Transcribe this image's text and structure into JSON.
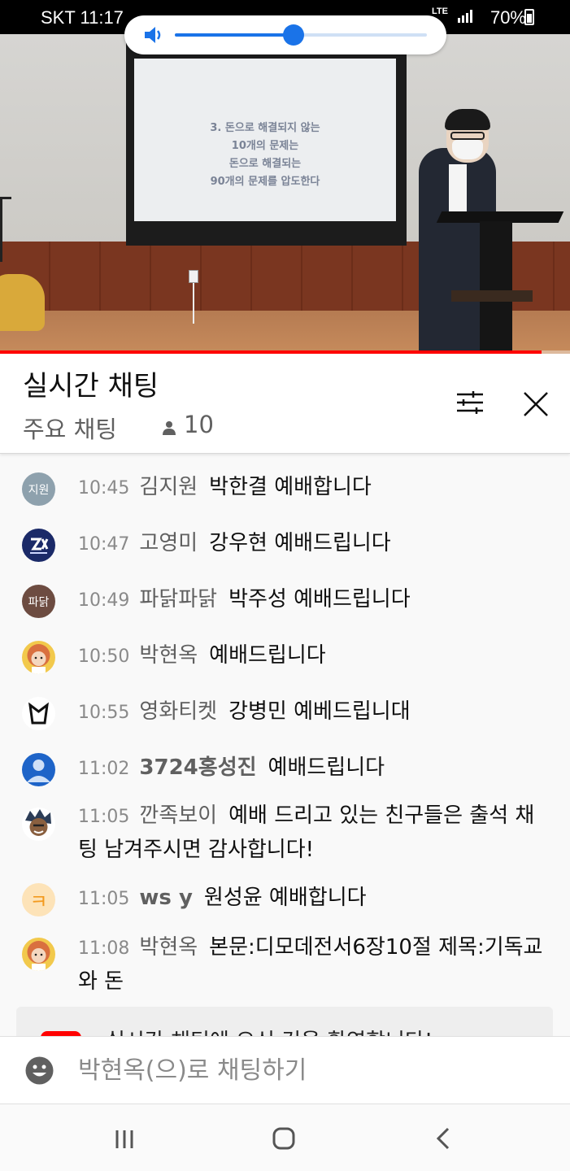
{
  "status_bar": {
    "carrier_time": "SKT 11:17",
    "network": "LTE",
    "battery": "70%"
  },
  "video": {
    "slide_lines": [
      "3. 돈으로 해결되지 않는",
      "10개의 문제는",
      "돈으로 해결되는",
      "90개의 문제를 압도한다"
    ],
    "progress_fraction": 0.95
  },
  "volume": {
    "level_fraction": 0.47,
    "icon": "speaker-icon"
  },
  "chat": {
    "title": "실시간 채팅",
    "mode": "주요 채팅",
    "viewer_count": "10",
    "filter_icon": "tune-icon",
    "close_icon": "close-icon"
  },
  "messages": [
    {
      "time": "10:45",
      "author": "김지원",
      "text": "박한결 예배합니다",
      "avatar_label": "지원",
      "avatar_color": "#8ea1ad"
    },
    {
      "time": "10:47",
      "author": "고영미",
      "text": "강우현 예배드립니다",
      "avatar_label": "",
      "avatar_color": "#1b2a68"
    },
    {
      "time": "10:49",
      "author": "파닭파닭",
      "text": "박주성 예배드립니다",
      "avatar_label": "파닭",
      "avatar_color": "#6d4c41"
    },
    {
      "time": "10:50",
      "author": "박현옥",
      "text": "예배드립니다",
      "avatar_label": "",
      "avatar_color": "#e8875a"
    },
    {
      "time": "10:55",
      "author": "영화티켓",
      "text": "강병민 예베드립니대",
      "avatar_label": "",
      "avatar_color": "#ffffff"
    },
    {
      "time": "11:02",
      "author": "3724홍성진",
      "text": "예배드립니다",
      "avatar_label": "",
      "avatar_color": "#1e64c8"
    },
    {
      "time": "11:05",
      "author": "깐족보이",
      "text": "예배 드리고 있는 친구들은 출석 채팅 남겨주시면 감사합니다!",
      "avatar_label": "",
      "avatar_color": "#2c3d57"
    },
    {
      "time": "11:05",
      "author": "ws y",
      "text": "원성윤 예배합니다",
      "avatar_label": "ㅋ",
      "avatar_color": "#fde3b8"
    },
    {
      "time": "11:08",
      "author": "박현옥",
      "text": "본문:디모데전서6장10절 제목:기독교와 돈",
      "avatar_label": "",
      "avatar_color": "#e8875a"
    }
  ],
  "welcome": {
    "text": "실시간 채팅에 오신 것을 환영합니다!"
  },
  "input": {
    "placeholder": "박현옥(으)로 채팅하기"
  },
  "nav": {
    "recent": "recent-apps-icon",
    "home": "home-icon",
    "back": "back-icon"
  }
}
